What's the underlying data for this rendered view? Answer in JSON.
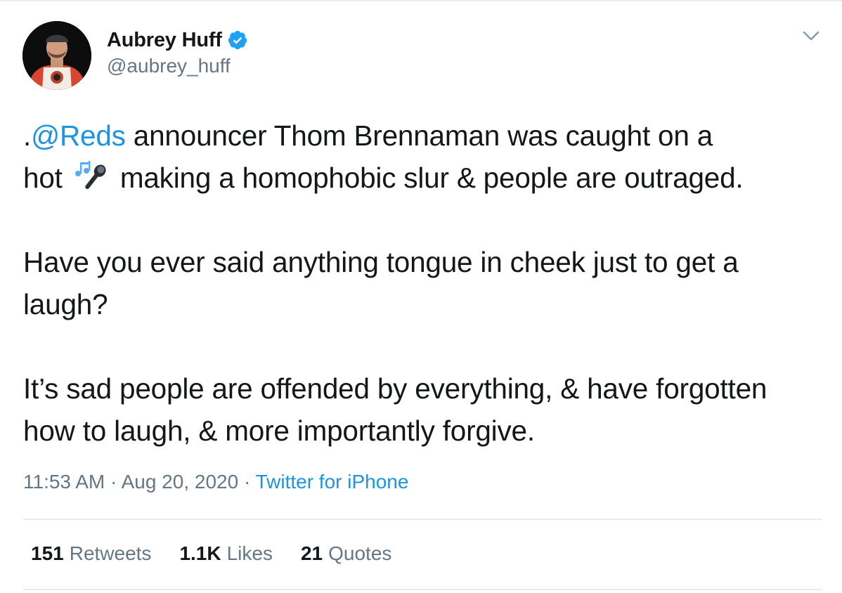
{
  "author": {
    "name": "Aubrey Huff",
    "handle": "@aubrey_huff",
    "verified": true
  },
  "tweet": {
    "line1_prefix": ".",
    "mention": "@Reds",
    "line1_rest": " announcer Thom Brennaman was caught on a",
    "line2_before_emoji": "hot ",
    "emoji": "microphone-music-emoji",
    "line2_after_emoji": " making a homophobic slur & people are outraged.",
    "paragraph2": "Have you ever said anything tongue in cheek just to get a laugh?",
    "paragraph3": "It’s sad people are offended by everything, & have forgotten how to laugh, & more importantly forgive."
  },
  "meta": {
    "time": "11:53 AM",
    "separator1": " · ",
    "date": "Aug 20, 2020",
    "separator2": " · ",
    "source": "Twitter for iPhone"
  },
  "stats": {
    "retweets_count": "151",
    "retweets_label": "Retweets",
    "likes_count": "1.1K",
    "likes_label": "Likes",
    "quotes_count": "21",
    "quotes_label": "Quotes"
  },
  "colors": {
    "link": "#1b95e0",
    "secondary_text": "#657786",
    "primary_text": "#14171a",
    "verified_badge": "#1da1f2"
  }
}
